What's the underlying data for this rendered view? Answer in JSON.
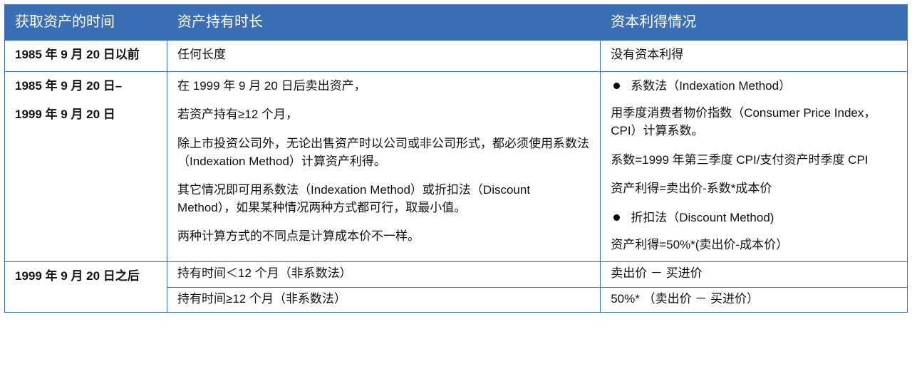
{
  "header": {
    "col1": "获取资产的时间",
    "col2": "资产持有时长",
    "col3": "资本利得情况"
  },
  "rows": {
    "r1": {
      "time": "1985 年 9 月 20 日以前",
      "duration": "任何长度",
      "gain": "没有资本利得"
    },
    "r2": {
      "time_line1": "1985 年 9 月 20 日–",
      "time_line2": "1999 年 9 月 20 日",
      "duration": {
        "p1": "在 1999 年 9 月 20 日后卖出资产，",
        "p2": "若资产持有≥12 个月，",
        "p3": "除上市投资公司外，无论出售资产时以公司或非公司形式，都必须使用系数法（Indexation Method）计算资产利得。",
        "p4": "其它情况即可用系数法（Indexation Method）或折扣法（Discount Method），如果某种情况两种方式都可行，取最小值。",
        "p5": "两种计算方式的不同点是计算成本价不一样。"
      },
      "gain": {
        "b1": "系数法（Indexation Method）",
        "g1": "用季度消费者物价指数（Consumer Price Index，CPI）计算系数。",
        "g2": "系数=1999 年第三季度 CPI/支付资产时季度 CPI",
        "g3": "资产利得=卖出价-系数*成本价",
        "b2": "折扣法（Discount Method)",
        "g4": "资产利得=50%*(卖出价-成本价）"
      }
    },
    "r3": {
      "time": "1999 年 9 月 20 日之后",
      "d1": "持有时间＜12 个月（非系数法）",
      "g1": "卖出价 － 买进价",
      "d2": "持有时间≥12 个月（非系数法）",
      "g2": "50%* （卖出价 － 买进价）"
    }
  }
}
